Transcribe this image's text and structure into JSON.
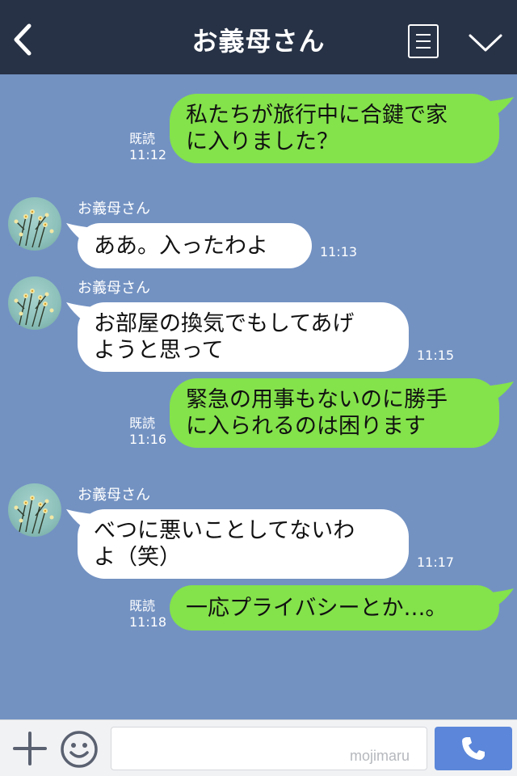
{
  "header": {
    "title": "お義母さん",
    "back_icon": "chevron-left-icon",
    "menu_icon": "menu-list-icon",
    "collapse_icon": "chevron-down-icon"
  },
  "messages": [
    {
      "direction": "sent",
      "text": "私たちが旅行中に合鍵で家\nに入りました？",
      "read": "既読",
      "time": "11:12"
    },
    {
      "direction": "received",
      "sender": "お義母さん",
      "text": "ああ。入ったわよ",
      "time": "11:13"
    },
    {
      "direction": "received",
      "sender": "お義母さん",
      "text": "お部屋の換気でもしてあげ\nようと思って",
      "time": "11:15"
    },
    {
      "direction": "sent",
      "text": "緊急の用事もないのに勝手\nに入られるのは困ります",
      "read": "既読",
      "time": "11:16"
    },
    {
      "direction": "received",
      "sender": "お義母さん",
      "text": "べつに悪いことしてないわ\nよ（笑）",
      "time": "11:17"
    },
    {
      "direction": "sent",
      "text": "一応プライバシーとか…。",
      "read": "既読",
      "time": "11:18"
    }
  ],
  "footer": {
    "input_value": "",
    "watermark": "mojimaru",
    "plus_icon": "plus-icon",
    "emoji_icon": "smiley-icon",
    "call_icon": "phone-icon"
  },
  "colors": {
    "header_bg": "#273246",
    "chat_bg": "#7392c2",
    "sent_bubble": "#84e24b",
    "received_bubble": "#ffffff",
    "call_button": "#5b86d9"
  }
}
